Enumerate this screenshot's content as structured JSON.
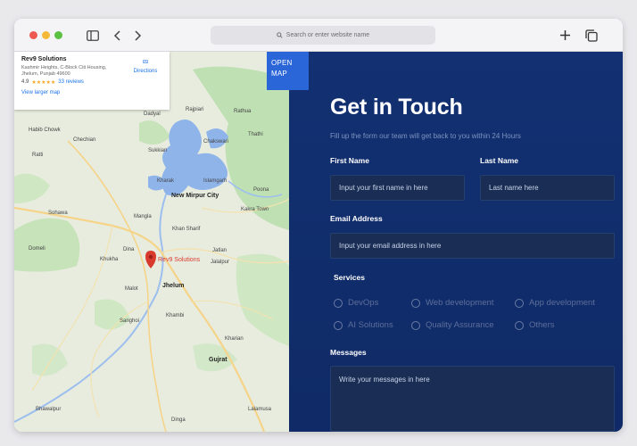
{
  "browser": {
    "url_placeholder": "Search or enter website name",
    "icons": [
      "sidebar-icon",
      "back-icon",
      "forward-icon",
      "new-tab-icon",
      "tabs-overview-icon"
    ]
  },
  "map": {
    "card": {
      "title": "Rev9 Solutions",
      "address": "Kashmir Heights, C-Block Citi Housing, Jhelum, Punjab 49600",
      "rating": "4.9",
      "stars": "★★★★★",
      "reviews": "33 reviews",
      "view_larger": "View larger map",
      "directions": "Directions"
    },
    "open_map": "OPEN MAP",
    "pin_label": "Rev9 Solutions",
    "places": {
      "dadyal": "Dadyal",
      "rajpiari": "Rajpiari",
      "rathua": "Rathua",
      "thathi": "Thathi",
      "habib_chowk": "Habib Chowk",
      "chakswari": "Chakswari",
      "chechian": "Chechian",
      "ratti": "Ratti",
      "sukkian": "Sukkian",
      "kharak": "Kharak",
      "islamgarh": "Islamgarh",
      "poona": "Poona",
      "new_mirpur": "New Mirpur City",
      "kakra_town": "Kakra Town",
      "sohawa": "Sohawa",
      "mangla": "Mangla",
      "khan_sharif": "Khan Sharif",
      "domeli": "Domeli",
      "dina": "Dina",
      "jatlan": "Jatlan",
      "khukha": "Khukha",
      "jalalpur": "Jalalpur",
      "malot": "Malot",
      "jhelum": "Jhelum",
      "khambi": "Khambi",
      "sanghoi": "Sanghoi",
      "kharian": "Kharian",
      "gujrat": "Gujrat",
      "lalamusa": "Lalamusa",
      "dinga": "Dinga",
      "bhawalpur": "Bhawalpur"
    }
  },
  "form": {
    "title": "Get in Touch",
    "subtitle": "Fill up the form our team will get back to you within 24 Hours",
    "first_name_label": "First Name",
    "first_name_placeholder": "Input your first name in here",
    "last_name_label": "Last Name",
    "last_name_placeholder": "Last name here",
    "email_label": "Email Address",
    "email_placeholder": "Input your email address in here",
    "services_label": "Services",
    "services": [
      "DevOps",
      "Web development",
      "App development",
      "AI Solutions",
      "Quality Assurance",
      "Others"
    ],
    "messages_label": "Messages",
    "messages_placeholder": "Write your messages in here"
  },
  "colors": {
    "panel_bg": "#123072",
    "field_bg": "#1a2e55",
    "open_map_bg": "#2b66d8",
    "pin": "#d93a2e"
  }
}
